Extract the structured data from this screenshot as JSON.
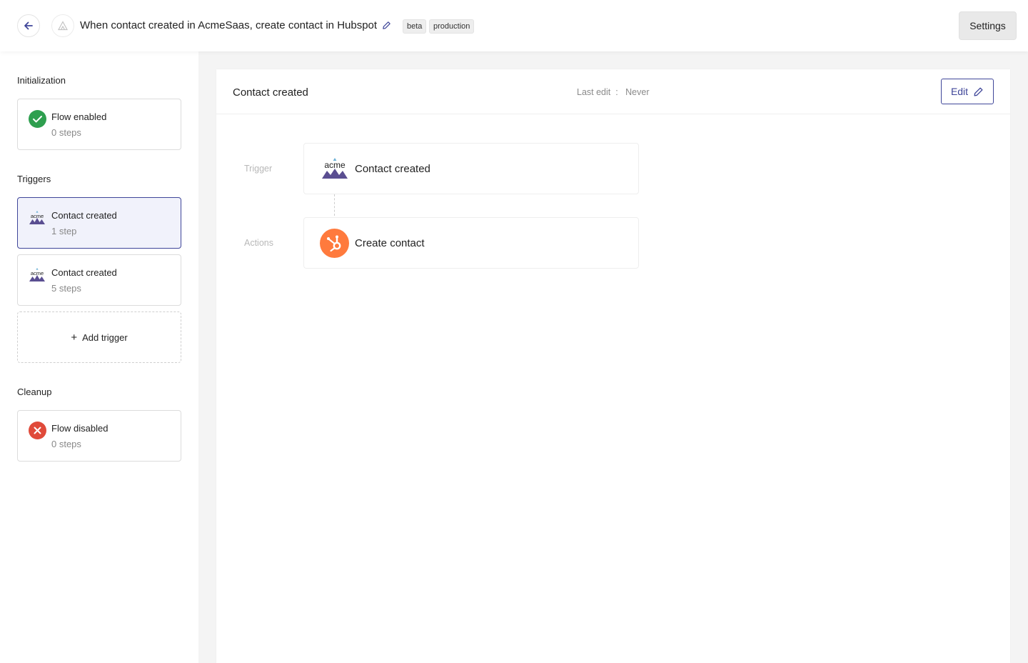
{
  "topbar": {
    "title": "When contact created in AcmeSaas, create contact in Hubspot",
    "tags": [
      "beta",
      "production"
    ],
    "settings_label": "Settings"
  },
  "sidebar": {
    "initialization": {
      "heading": "Initialization",
      "card": {
        "title": "Flow enabled",
        "subtitle": "0 steps",
        "icon": "check-circle-icon",
        "color": "#2e9f4f"
      }
    },
    "triggers": {
      "heading": "Triggers",
      "items": [
        {
          "title": "Contact created",
          "subtitle": "1 step",
          "icon": "acme-logo-icon",
          "selected": true
        },
        {
          "title": "Contact created",
          "subtitle": "5 steps",
          "icon": "acme-logo-icon",
          "selected": false
        }
      ],
      "add_label": "Add trigger"
    },
    "cleanup": {
      "heading": "Cleanup",
      "card": {
        "title": "Flow disabled",
        "subtitle": "0 steps",
        "icon": "x-circle-icon",
        "color": "#e04a3a"
      }
    }
  },
  "main": {
    "title": "Contact created",
    "last_edit_label": "Last edit",
    "last_edit_value": "Never",
    "edit_label": "Edit",
    "flow": {
      "trigger_label": "Trigger",
      "trigger": {
        "title": "Contact created",
        "icon": "acme-logo-icon"
      },
      "actions_label": "Actions",
      "actions": [
        {
          "title": "Create contact",
          "icon": "hubspot-logo-icon",
          "color": "#ff7a3d"
        }
      ]
    }
  },
  "colors": {
    "accent": "#3f4699",
    "selected_bg": "#f1f2fb",
    "acme_purple": "#5a4e91"
  }
}
